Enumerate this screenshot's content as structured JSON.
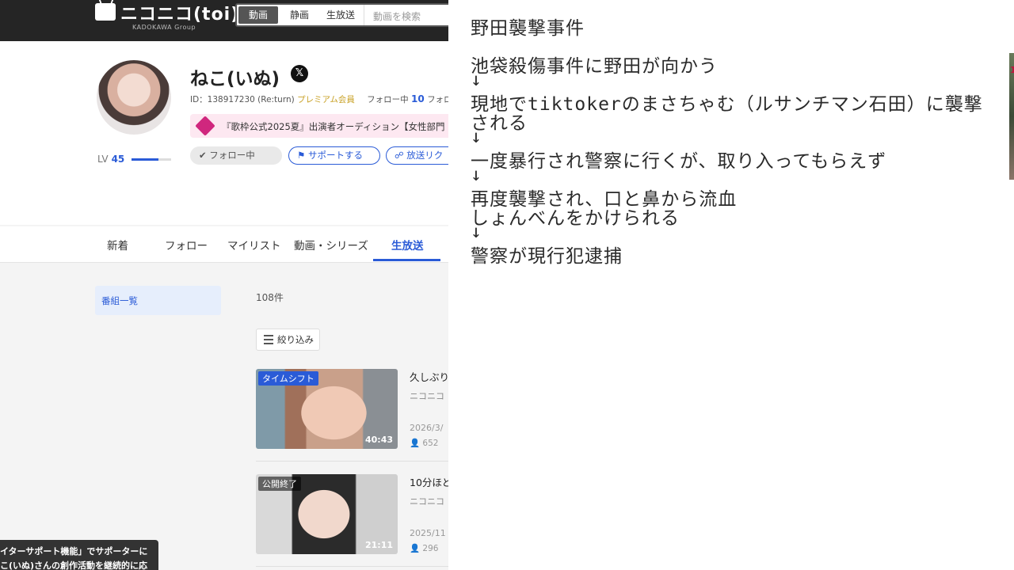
{
  "header": {
    "logo_text": "ニコニコ(toi)",
    "logo_sub": "KADOKAWA Group",
    "search_tabs": [
      "動画",
      "静画",
      "生放送"
    ],
    "search_placeholder": "動画を検索"
  },
  "profile": {
    "name": "ねこ(いぬ)",
    "x_icon_label": "𝕏",
    "id_text": "ID：138917230 (Re:turn)",
    "premium": "プレミアム会員",
    "following_label": "フォロー中",
    "following_count": "10",
    "followers_label": "フォロ",
    "banner_text": "『歌枠公式2025夏』出演者オーディション【女性部門",
    "level_label": "LV",
    "level": "45",
    "level_progress": 0.68,
    "buttons": {
      "follow": "✔ フォロー中",
      "support": "⚑ サポートする",
      "request": "☍ 放送リク"
    }
  },
  "tabs": [
    "新着",
    "フォロー",
    "マイリスト",
    "動画・シリーズ",
    "生放送"
  ],
  "active_tab": "生放送",
  "sidebar": {
    "program_list": "番組一覧"
  },
  "list": {
    "count": "108件",
    "filter_label": "絞り込み",
    "videos": [
      {
        "badge": "タイムシフト",
        "duration": "40:43",
        "title": "久しぶり",
        "channel": "ニコニコ",
        "date": "2026/3/",
        "views": "👤 652"
      },
      {
        "badge": "公開終了",
        "duration": "21:11",
        "title": "10分ほど",
        "channel": "ニコニコ",
        "date": "2025/11",
        "views": "👤 296"
      }
    ]
  },
  "tooltip": {
    "line1": "イターサポート機能」でサポーターに",
    "line2": "こ(いぬ)さんの創作活動を継続的に応"
  },
  "memo": {
    "lines": [
      "野田襲撃事件",
      "池袋殺傷事件に野田が向かう",
      "↓",
      "現地でtiktokerのまさちゃむ（ルサンチマン石田）に襲撃",
      "される",
      "↓",
      "一度暴行され警察に行くが、取り入ってもらえず",
      "↓",
      "再度襲撃され、口と鼻から流血",
      "しょんべんをかけられる",
      "↓",
      "警察が現行犯逮捕"
    ]
  },
  "edge_text": "1"
}
